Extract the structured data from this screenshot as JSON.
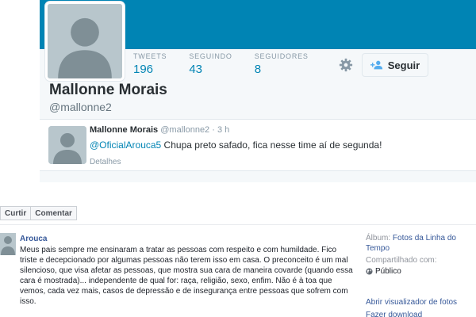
{
  "twitter": {
    "stats": [
      {
        "label": "TWEETS",
        "value": "196"
      },
      {
        "label": "SEGUINDO",
        "value": "43"
      },
      {
        "label": "SEGUIDORES",
        "value": "8"
      }
    ],
    "follow_label": "Seguir",
    "profile_name": "Mallonne Morais",
    "profile_handle": "@mallonne2",
    "tweet": {
      "author": "Mallonne Morais",
      "handle": "@mallonne2",
      "separator": "·",
      "time": "3 h",
      "mention": "@OficialArouca5",
      "text": " Chupa preto safado, fica nesse time aí de segunda!",
      "details": "Detalhes"
    },
    "colors": {
      "brand": "#0084b4",
      "link": "#0084b4"
    }
  },
  "facebook": {
    "actions": [
      "Curtir",
      "Comentar"
    ],
    "post": {
      "author": "Arouca",
      "body": "Meus pais sempre me ensinaram a tratar as pessoas com respeito e com humildade. Fico triste e decepcionado por algumas pessoas não terem isso em casa. O preconceito é um mal silencioso, que visa afetar as pessoas, que mostra sua cara de maneira covarde (quando essa cara é mostrada)... independente de qual for: raça, religião, sexo, enfim. Não é à toa que vemos, cada vez mais, casos de depressão e de insegurança entre pessoas que sofrem com isso."
    },
    "sidebar": {
      "album_label": "Álbum:",
      "album_name": "Fotos da Linha do Tempo",
      "shared_label": "Compartilhado com:",
      "shared_value": "Público",
      "viewer_link": "Abrir visualizador de fotos",
      "download_link": "Fazer download"
    },
    "colors": {
      "link": "#365899"
    }
  },
  "icons": [
    "gear-icon",
    "add-person-icon",
    "globe-icon"
  ]
}
